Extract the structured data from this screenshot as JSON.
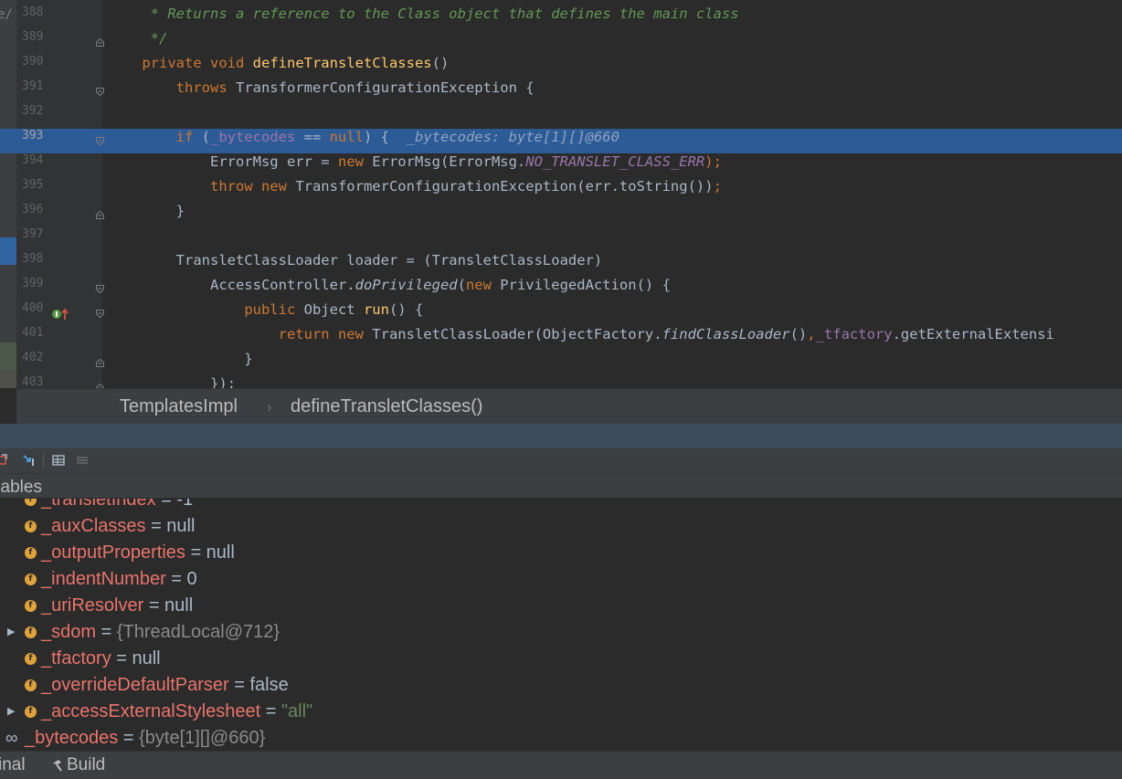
{
  "editor": {
    "path_fragment": "e/",
    "lines": [
      {
        "n": "388",
        "parts": [
          {
            "t": "     * Returns a reference to the Class object that defines the main class",
            "c": "cm"
          }
        ]
      },
      {
        "n": "389",
        "parts": [
          {
            "t": "     */",
            "c": "cm"
          }
        ]
      },
      {
        "n": "390",
        "parts": [
          {
            "t": "    ",
            "c": ""
          },
          {
            "t": "private void ",
            "c": "kw"
          },
          {
            "t": "defineTransletClasses",
            "c": "fn"
          },
          {
            "t": "()",
            "c": ""
          }
        ]
      },
      {
        "n": "391",
        "parts": [
          {
            "t": "        ",
            "c": ""
          },
          {
            "t": "throws ",
            "c": "kw"
          },
          {
            "t": "TransformerConfigurationException {",
            "c": ""
          }
        ]
      },
      {
        "n": "392",
        "parts": []
      },
      {
        "n": "393",
        "current": true,
        "parts": [
          {
            "t": "        ",
            "c": ""
          },
          {
            "t": "if ",
            "c": "kw"
          },
          {
            "t": "(",
            "c": ""
          },
          {
            "t": "_bytecodes",
            "c": "fld"
          },
          {
            "t": " == ",
            "c": ""
          },
          {
            "t": "null",
            "c": "kw"
          },
          {
            "t": ") {  ",
            "c": ""
          },
          {
            "t": "_bytecodes: byte[1][]@660",
            "c": "hint"
          }
        ]
      },
      {
        "n": "394",
        "parts": [
          {
            "t": "            ErrorMsg err = ",
            "c": ""
          },
          {
            "t": "new ",
            "c": "kw"
          },
          {
            "t": "ErrorMsg(ErrorMsg.",
            "c": ""
          },
          {
            "t": "NO_TRANSLET_CLASS_ERR",
            "c": "st"
          },
          {
            "t": ");",
            "c": "kw"
          }
        ]
      },
      {
        "n": "395",
        "parts": [
          {
            "t": "            ",
            "c": ""
          },
          {
            "t": "throw new ",
            "c": "kw"
          },
          {
            "t": "TransformerConfigurationException(err.toString())",
            "c": ""
          },
          {
            "t": ";",
            "c": "kw"
          }
        ]
      },
      {
        "n": "396",
        "parts": [
          {
            "t": "        }",
            "c": ""
          }
        ]
      },
      {
        "n": "397",
        "parts": []
      },
      {
        "n": "398",
        "parts": [
          {
            "t": "        TransletClassLoader loader = (TransletClassLoader)",
            "c": ""
          }
        ]
      },
      {
        "n": "399",
        "parts": [
          {
            "t": "            AccessController.",
            "c": ""
          },
          {
            "t": "doPrivileged",
            "c": "itm"
          },
          {
            "t": "(",
            "c": ""
          },
          {
            "t": "new ",
            "c": "kw"
          },
          {
            "t": "PrivilegedAction() {",
            "c": ""
          }
        ]
      },
      {
        "n": "400",
        "marker": true,
        "parts": [
          {
            "t": "                ",
            "c": ""
          },
          {
            "t": "public ",
            "c": "kw"
          },
          {
            "t": "Object ",
            "c": ""
          },
          {
            "t": "run",
            "c": "fn"
          },
          {
            "t": "() {",
            "c": ""
          }
        ]
      },
      {
        "n": "401",
        "parts": [
          {
            "t": "                    ",
            "c": ""
          },
          {
            "t": "return new ",
            "c": "kw"
          },
          {
            "t": "TransletClassLoader(ObjectFactory.",
            "c": ""
          },
          {
            "t": "findClassLoader",
            "c": "itm"
          },
          {
            "t": "()",
            "c": ""
          },
          {
            "t": ",",
            "c": "kw"
          },
          {
            "t": "_tfactory",
            "c": "fld"
          },
          {
            "t": ".getExternalExtensi",
            "c": ""
          }
        ]
      },
      {
        "n": "402",
        "parts": [
          {
            "t": "                }",
            "c": ""
          }
        ]
      },
      {
        "n": "403",
        "parts": [
          {
            "t": "            });",
            "c": ""
          }
        ]
      }
    ]
  },
  "breadcrumb": {
    "class_name": "TemplatesImpl",
    "separator": "›",
    "method_name": "defineTransletClasses()"
  },
  "variables": {
    "header": "Variables",
    "header_visible": "riables",
    "items": [
      {
        "name": "_transletIndex",
        "rest": " = -1",
        "kind": "field"
      },
      {
        "name": "_auxClasses",
        "rest": " = null",
        "kind": "field"
      },
      {
        "name": "_outputProperties",
        "rest": " = null",
        "kind": "field"
      },
      {
        "name": "_indentNumber",
        "rest": " = 0",
        "kind": "field"
      },
      {
        "name": "_uriResolver",
        "rest": " = null",
        "kind": "field"
      },
      {
        "name": "_sdom",
        "eq": " = ",
        "dim": "{ThreadLocal@712}",
        "kind": "field",
        "expandable": true
      },
      {
        "name": "_tfactory",
        "rest": " = null",
        "kind": "field"
      },
      {
        "name": "_overrideDefaultParser",
        "rest": " = false",
        "kind": "field"
      },
      {
        "name": "_accessExternalStylesheet",
        "eq": " = ",
        "str": "\"all\"",
        "kind": "field",
        "expandable": true
      },
      {
        "name": "_bytecodes",
        "eq": " = ",
        "dim": "{byte[1][]@660}",
        "kind": "watch"
      }
    ]
  },
  "bottom_bar": {
    "terminal_label": "inal",
    "build_label": "Build"
  },
  "icons": {
    "field_badge": "field-icon",
    "watch": "watch-glasses-icon",
    "expand": "expand-arrow-icon",
    "build": "hammer-icon"
  },
  "colors": {
    "keyword": "#cc7832",
    "method": "#ffc66d",
    "field": "#9876aa",
    "comment": "#629755",
    "highlight": "#2d5b95",
    "var_name": "#e8746b",
    "string": "#6a8759"
  }
}
